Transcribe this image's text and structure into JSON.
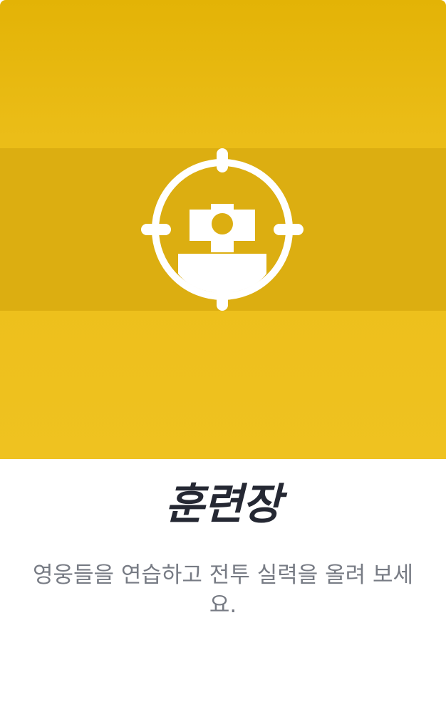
{
  "card": {
    "title": "훈련장",
    "description": "영웅들을 연습하고 전투 실력을 올려 보세요.",
    "icon": "training-target-icon",
    "colors": {
      "banner": "#efc220",
      "band": "#dcae11",
      "title": "#252833",
      "description": "#777b84",
      "icon": "#ffffff"
    }
  }
}
